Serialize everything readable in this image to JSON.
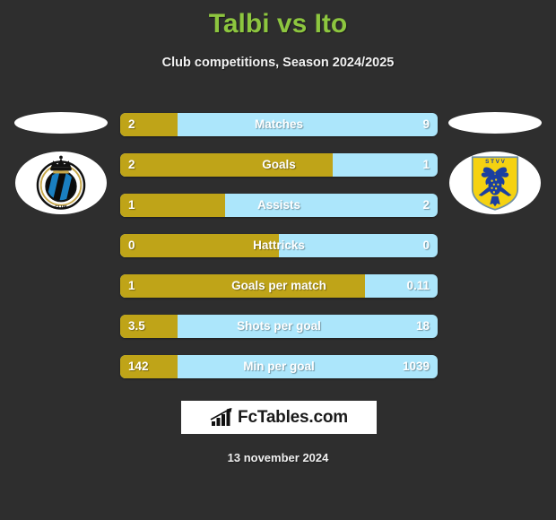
{
  "header": {
    "title": "Talbi vs Ito",
    "subtitle": "Club competitions, Season 2024/2025",
    "title_color": "#8dc63f"
  },
  "teams": {
    "home": {
      "name": "Club Brugge KV",
      "badge": "club-brugge-crest",
      "crest_text": "CLUB BRUGGE KV"
    },
    "away": {
      "name": "Sint-Truidense VV",
      "badge": "stvv-crest",
      "crest_text": "S T V V"
    }
  },
  "colors": {
    "home_bar": "#bfa418",
    "away_bar": "#ace6fb",
    "background": "#2e2e2e",
    "accent": "#8dc63f"
  },
  "stats": [
    {
      "label": "Matches",
      "home": "2",
      "away": "9",
      "home_percent": 18
    },
    {
      "label": "Goals",
      "home": "2",
      "away": "1",
      "home_percent": 67
    },
    {
      "label": "Assists",
      "home": "1",
      "away": "2",
      "home_percent": 33
    },
    {
      "label": "Hattricks",
      "home": "0",
      "away": "0",
      "home_percent": 50
    },
    {
      "label": "Goals per match",
      "home": "1",
      "away": "0.11",
      "home_percent": 77
    },
    {
      "label": "Shots per goal",
      "home": "3.5",
      "away": "18",
      "home_percent": 18
    },
    {
      "label": "Min per goal",
      "home": "142",
      "away": "1039",
      "home_percent": 18
    }
  ],
  "footer": {
    "logo_text": "FcTables.com",
    "logo_icon": "bar-chart-icon",
    "date": "13 november 2024"
  }
}
